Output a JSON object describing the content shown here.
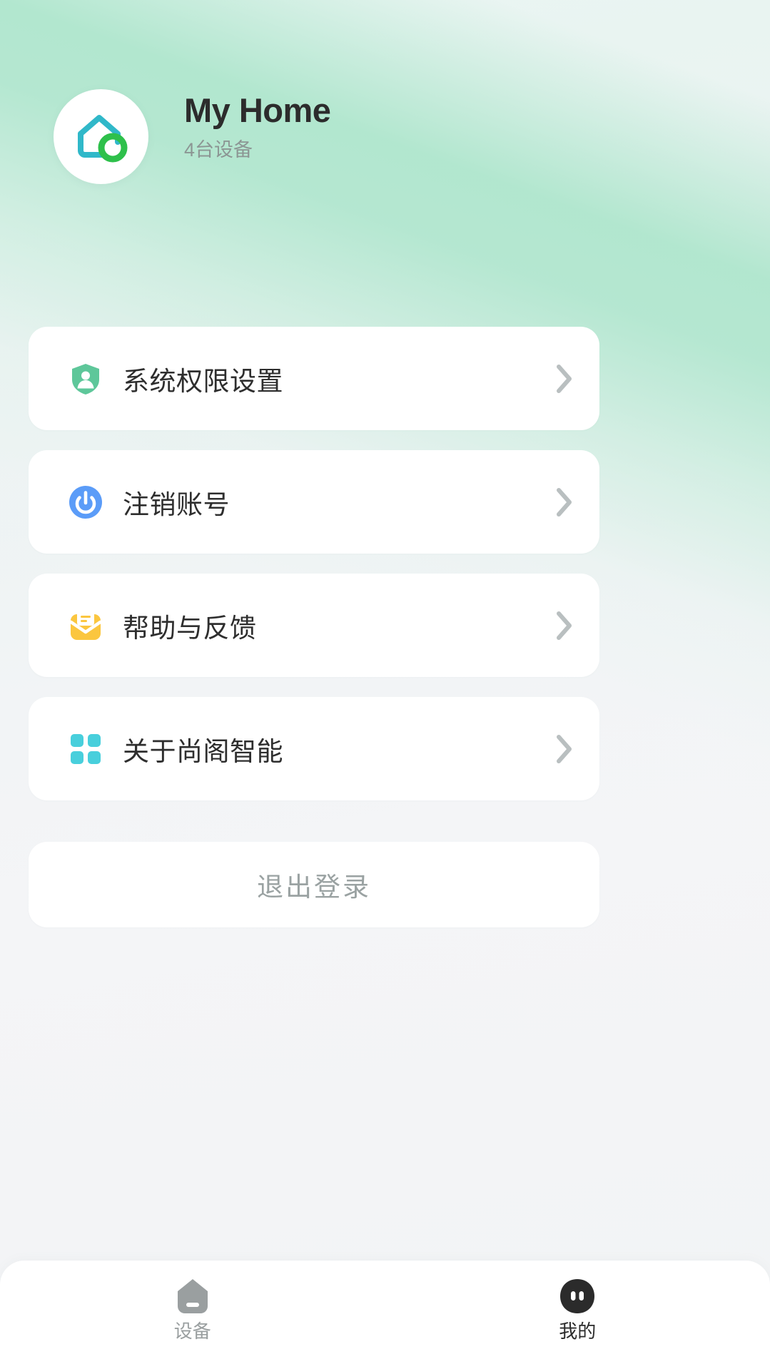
{
  "header": {
    "logo_icon": "home-logo-icon",
    "title": "My Home",
    "subtitle": "4台设备"
  },
  "menu": {
    "items": [
      {
        "icon": "shield-person-icon",
        "icon_color": "#5ec79a",
        "label": "系统权限设置",
        "chevron": "chevron-right-icon"
      },
      {
        "icon": "power-button-icon",
        "icon_color": "#5b9cf8",
        "label": "注销账号",
        "chevron": "chevron-right-icon"
      },
      {
        "icon": "envelope-message-icon",
        "icon_color": "#fbc63f",
        "label": "帮助与反馈",
        "chevron": "chevron-right-icon"
      },
      {
        "icon": "grid-squares-icon",
        "icon_color": "#48cfdc",
        "label": "关于尚阁智能",
        "chevron": "chevron-right-icon"
      }
    ]
  },
  "logout": {
    "label": "退出登录"
  },
  "tabbar": {
    "tabs": [
      {
        "icon": "home-outline-icon",
        "label": "设备",
        "active": false,
        "color": "#9a9fa0"
      },
      {
        "icon": "profile-face-icon",
        "label": "我的",
        "active": true,
        "color": "#2b2b2b"
      }
    ]
  },
  "colors": {
    "accent_teal": "#30b8c9",
    "accent_green": "#2ec04b",
    "background_top": "#b3e6cd",
    "background_bottom": "#f4f5f7",
    "card": "#ffffff",
    "text_primary": "#2e2e2e",
    "text_muted": "#8c9694"
  }
}
